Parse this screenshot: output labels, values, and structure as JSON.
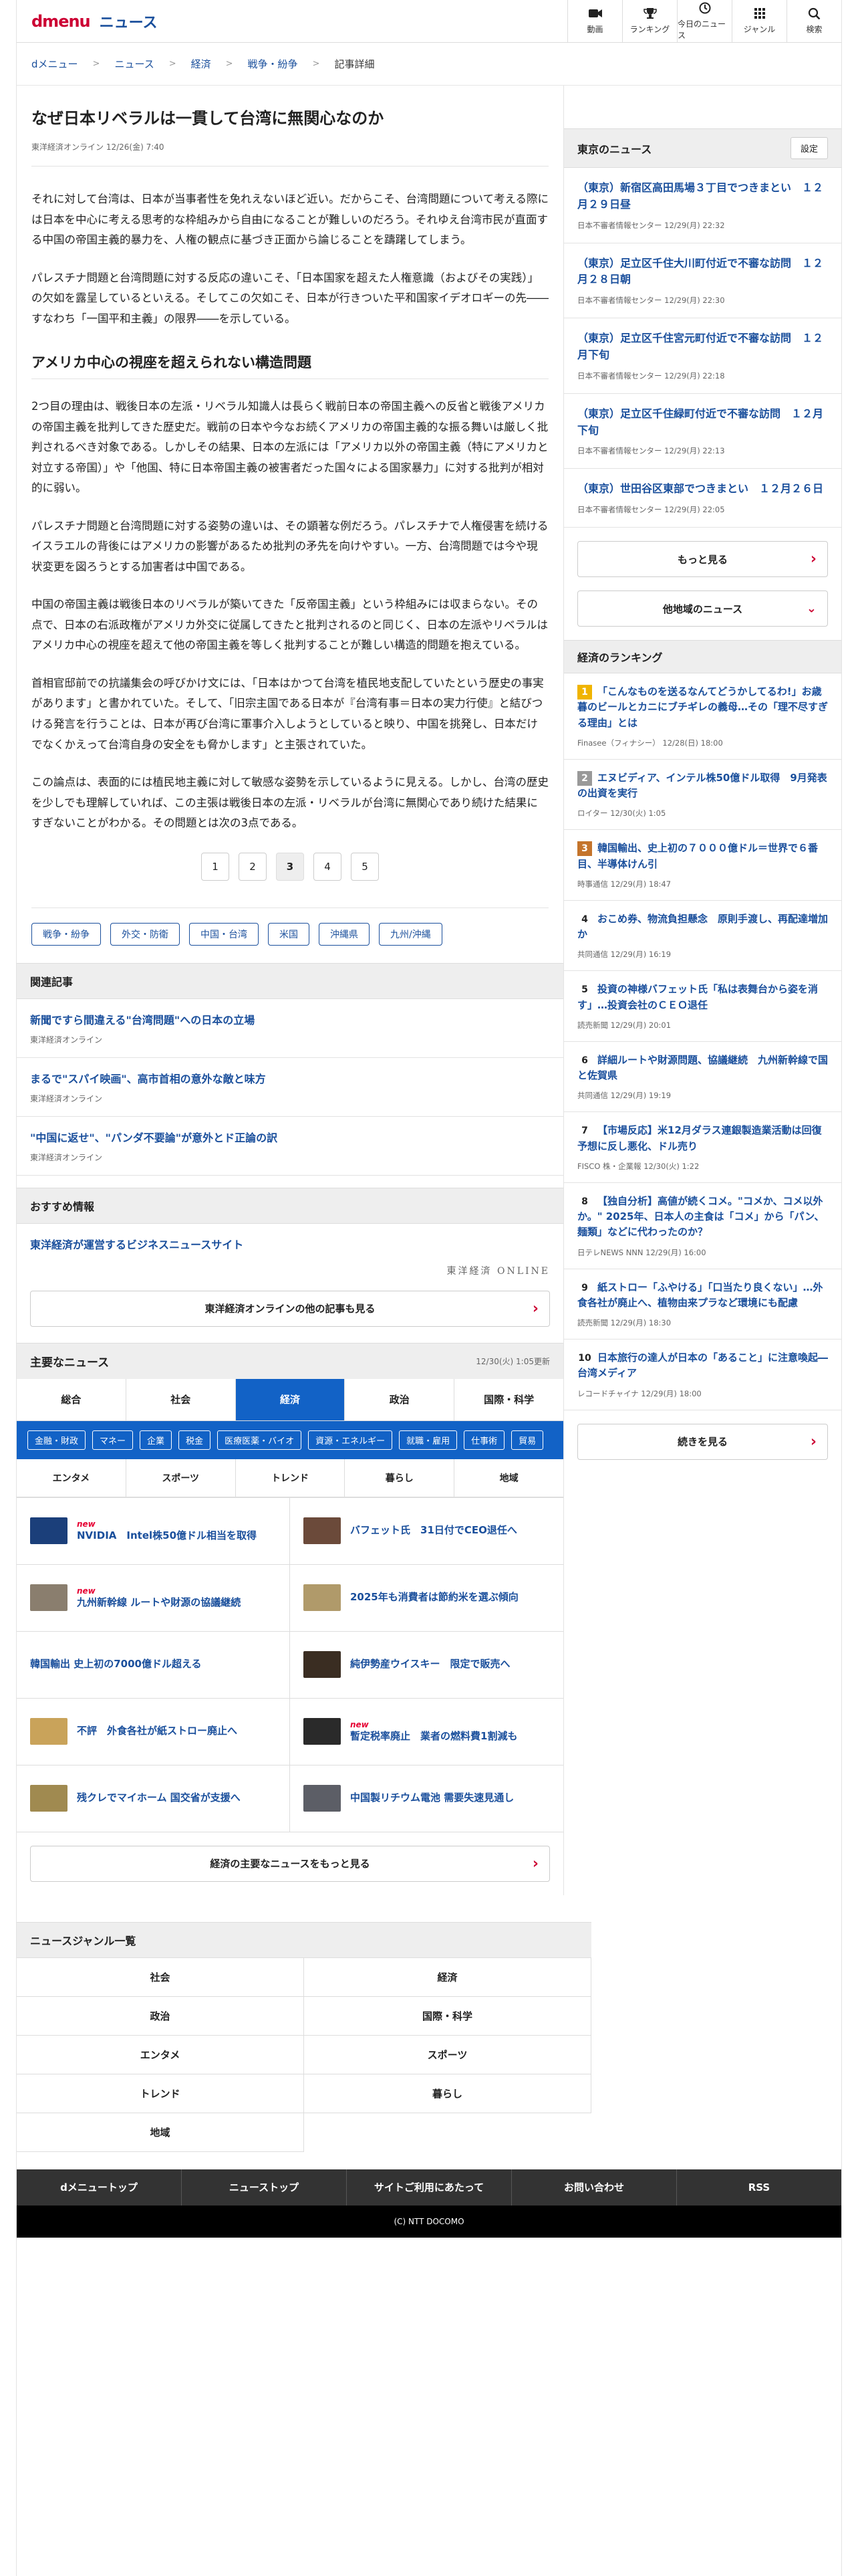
{
  "header": {
    "logo_dmenu": "dmenu",
    "logo_news": "ニュース",
    "nav": [
      {
        "label": "動画",
        "icon": "video-icon"
      },
      {
        "label": "ランキング",
        "icon": "trophy-icon"
      },
      {
        "label": "今日のニュース",
        "icon": "clock-icon"
      },
      {
        "label": "ジャンル",
        "icon": "grid-icon"
      },
      {
        "label": "検索",
        "icon": "search-icon"
      }
    ]
  },
  "breadcrumb": [
    "dメニュー",
    "ニュース",
    "経済",
    "戦争・紛争",
    "記事詳細"
  ],
  "article": {
    "title": "なぜ日本リベラルは一貫して台湾に無関心なのか",
    "meta": "東洋経済オンライン 12/26(金) 7:40",
    "p1": "それに対して台湾は、日本が当事者性を免れえないほど近い。だからこそ、台湾問題について考える際には日本を中心に考える思考的な枠組みから自由になることが難しいのだろう。それゆえ台湾市民が直面する中国の帝国主義的暴力を、人権の観点に基づき正面から論じることを躊躇してしまう。",
    "p2": "パレスチナ問題と台湾問題に対する反応の違いこそ、「日本国家を超えた人権意識（およびその実践）」の欠如を露呈しているといえる。そしてこの欠如こそ、日本が行きついた平和国家イデオロギーの先――すなわち「一国平和主義」の限界――を示している。",
    "h2": "アメリカ中心の視座を超えられない構造問題",
    "p3": "2つ目の理由は、戦後日本の左派・リベラル知識人は長らく戦前日本の帝国主義への反省と戦後アメリカの帝国主義を批判してきた歴史だ。戦前の日本や今なお続くアメリカの帝国主義的な振る舞いは厳しく批判されるべき対象である。しかしその結果、日本の左派には「アメリカ以外の帝国主義（特にアメリカと対立する帝国）」や「他国、特に日本帝国主義の被害者だった国々による国家暴力」に対する批判が相対的に弱い。",
    "p4": "パレスチナ問題と台湾問題に対する姿勢の違いは、その顕著な例だろう。パレスチナで人権侵害を続けるイスラエルの背後にはアメリカの影響があるため批判の矛先を向けやすい。一方、台湾問題では今や現状変更を図ろうとする加害者は中国である。",
    "p5": "中国の帝国主義は戦後日本のリベラルが築いてきた「反帝国主義」という枠組みには収まらない。その点で、日本の右派政権がアメリカ外交に従属してきたと批判されるのと同じく、日本の左派やリベラルはアメリカ中心の視座を超えて他の帝国主義を等しく批判することが難しい構造的問題を抱えている。",
    "p6": "首相官邸前での抗議集会の呼びかけ文には、「日本はかつて台湾を植民地支配していたという歴史の事実があります」と書かれていた。そして、「旧宗主国である日本が『台湾有事＝日本の実力行使』と結びつける発言を行うことは、日本が再び台湾に軍事介入しようとしていると映り、中国を挑発し、日本だけでなくかえって台湾自身の安全をも脅かします」と主張されていた。",
    "p7": "この論点は、表面的には植民地主義に対して敏感な姿勢を示しているように見える。しかし、台湾の歴史を少しでも理解していれば、この主張は戦後日本の左派・リベラルが台湾に無関心であり続けた結果にすぎないことがわかる。その問題とは次の3点である。",
    "pages": [
      "1",
      "2",
      "3",
      "4",
      "5"
    ],
    "current_page": "3",
    "tags": [
      "戦争・紛争",
      "外交・防衛",
      "中国・台湾",
      "米国",
      "沖縄県",
      "九州/沖縄"
    ]
  },
  "related": {
    "heading": "関連記事",
    "items": [
      {
        "title": "新聞ですら間違える\"台湾問題\"への日本の立場",
        "source": "東洋経済オンライン"
      },
      {
        "title": "まるで\"スパイ映画\"、高市首相の意外な敵と味方",
        "source": "東洋経済オンライン"
      },
      {
        "title": "\"中国に返せ\"、\"パンダ不要論\"が意外とド正論の訳",
        "source": "東洋経済オンライン"
      }
    ]
  },
  "recommend": {
    "heading": "おすすめ情報",
    "link": "東洋経済が運営するビジネスニュースサイト",
    "logo_text": "東洋経済 ONLINE",
    "more": "東洋経済オンラインの他の記事も見る"
  },
  "major": {
    "heading": "主要なニュース",
    "date": "12/30(火) 1:05更新",
    "tabs": [
      "総合",
      "社会",
      "経済",
      "政治",
      "国際・科学"
    ],
    "active_tab": "経済",
    "subtabs": [
      "金融・財政",
      "マネー",
      "企業",
      "税金",
      "医療医薬・バイオ",
      "資源・エネルギー",
      "就職・雇用",
      "仕事術",
      "貿易"
    ],
    "tabs2": [
      "エンタメ",
      "スポーツ",
      "トレンド",
      "暮らし",
      "地域"
    ],
    "items": [
      {
        "title": "NVIDIA　Intel株50億ドル相当を取得",
        "new": "new",
        "thumb": "#1b3f7a"
      },
      {
        "title": "バフェット氏　31日付でCEO退任へ",
        "new": "",
        "thumb": "#6b4a3a"
      },
      {
        "title": "九州新幹線 ルートや財源の協議継続",
        "new": "new",
        "thumb": "#8a7e6e"
      },
      {
        "title": "2025年も消費者は節約米を選ぶ傾向",
        "new": "",
        "thumb": "#b09a6a"
      },
      {
        "title": "韓国輸出 史上初の7000億ドル超える",
        "new": "",
        "thumb": ""
      },
      {
        "title": "純伊勢産ウイスキー　限定で販売へ",
        "new": "",
        "thumb": "#3a2d22"
      },
      {
        "title": "不評　外食各社が紙ストロー廃止へ",
        "new": "",
        "thumb": "#c9a35a"
      },
      {
        "title": "暫定税率廃止　業者の燃料費1割減も",
        "new": "new",
        "thumb": "#2a2a2a"
      },
      {
        "title": "残クレでマイホーム 国交省が支援へ",
        "new": "",
        "thumb": "#a08a50"
      },
      {
        "title": "中国製リチウム電池 需要失速見通し",
        "new": "",
        "thumb": "#5c5e66"
      }
    ],
    "more": "経済の主要なニュースをもっと見る"
  },
  "genre": {
    "heading": "ニュースジャンル一覧",
    "items": [
      "社会",
      "経済",
      "政治",
      "国際・科学",
      "エンタメ",
      "スポーツ",
      "トレンド",
      "暮らし",
      "地域"
    ]
  },
  "footer": {
    "links": [
      "dメニュートップ",
      "ニューストップ",
      "サイトご利用にあたって",
      "お問い合わせ",
      "RSS"
    ],
    "copyright": "(C) NTT DOCOMO"
  },
  "sidebar": {
    "tokyo_heading": "東京のニュース",
    "settings": "設定",
    "tokyo": [
      {
        "title": "（東京）新宿区高田馬場３丁目でつきまとい　１２月２９日昼",
        "source": "日本不審者情報センター 12/29(月) 22:32"
      },
      {
        "title": "（東京）足立区千住大川町付近で不審な訪問　１２月２８日朝",
        "source": "日本不審者情報センター 12/29(月) 22:30"
      },
      {
        "title": "（東京）足立区千住宮元町付近で不審な訪問　１２月下旬",
        "source": "日本不審者情報センター 12/29(月) 22:18"
      },
      {
        "title": "（東京）足立区千住緑町付近で不審な訪問　１２月下旬",
        "source": "日本不審者情報センター 12/29(月) 22:13"
      },
      {
        "title": "（東京）世田谷区東部でつきまとい　１２月２６日",
        "source": "日本不審者情報センター 12/29(月) 22:05"
      }
    ],
    "more": "もっと見る",
    "other_region": "他地域のニュース",
    "ranking_heading": "経済のランキング",
    "ranking": [
      {
        "rank": "1",
        "title": "「こんなものを送るなんてどうかしてるわ!」お歳暮のビールとカニにブチギレの義母…その「理不尽すぎる理由」とは",
        "source": "Finasee（フィナシー） 12/28(日) 18:00"
      },
      {
        "rank": "2",
        "title": "エヌビディア、インテル株50億ドル取得　9月発表の出資を実行",
        "source": "ロイター 12/30(火) 1:05"
      },
      {
        "rank": "3",
        "title": "韓国輸出、史上初の７０００億ドル＝世界で６番目、半導体けん引",
        "source": "時事通信 12/29(月) 18:47"
      },
      {
        "rank": "4",
        "title": "おこめ券、物流負担懸念　原則手渡し、再配達増加か",
        "source": "共同通信 12/29(月) 16:19"
      },
      {
        "rank": "5",
        "title": "投資の神様バフェット氏「私は表舞台から姿を消す」…投資会社のＣＥＯ退任",
        "source": "読売新聞 12/29(月) 20:01"
      },
      {
        "rank": "6",
        "title": "詳細ルートや財源問題、協議継続　九州新幹線で国と佐賀県",
        "source": "共同通信 12/29(月) 19:19"
      },
      {
        "rank": "7",
        "title": "【市場反応】米12月ダラス連銀製造業活動は回復予想に反し悪化、ドル売り",
        "source": "FISCO 株・企業報 12/30(火) 1:22"
      },
      {
        "rank": "8",
        "title": "【独自分析】高値が続くコメ。\"コメか、コメ以外か。\" 2025年、日本人の主食は「コメ」から「パン、麺類」などに代わったのか？",
        "source": "日テレNEWS NNN 12/29(月) 16:00"
      },
      {
        "rank": "9",
        "title": "紙ストロー「ふやける」「口当たり良くない」…外食各社が廃止へ、植物由来プラなど環境にも配慮",
        "source": "読売新聞 12/29(月) 18:30"
      },
      {
        "rank": "10",
        "title": "日本旅行の達人が日本の「あること」に注意喚起―台湾メディア",
        "source": "レコードチャイナ 12/29(月) 18:00"
      }
    ],
    "ranking_more": "続きを見る"
  }
}
